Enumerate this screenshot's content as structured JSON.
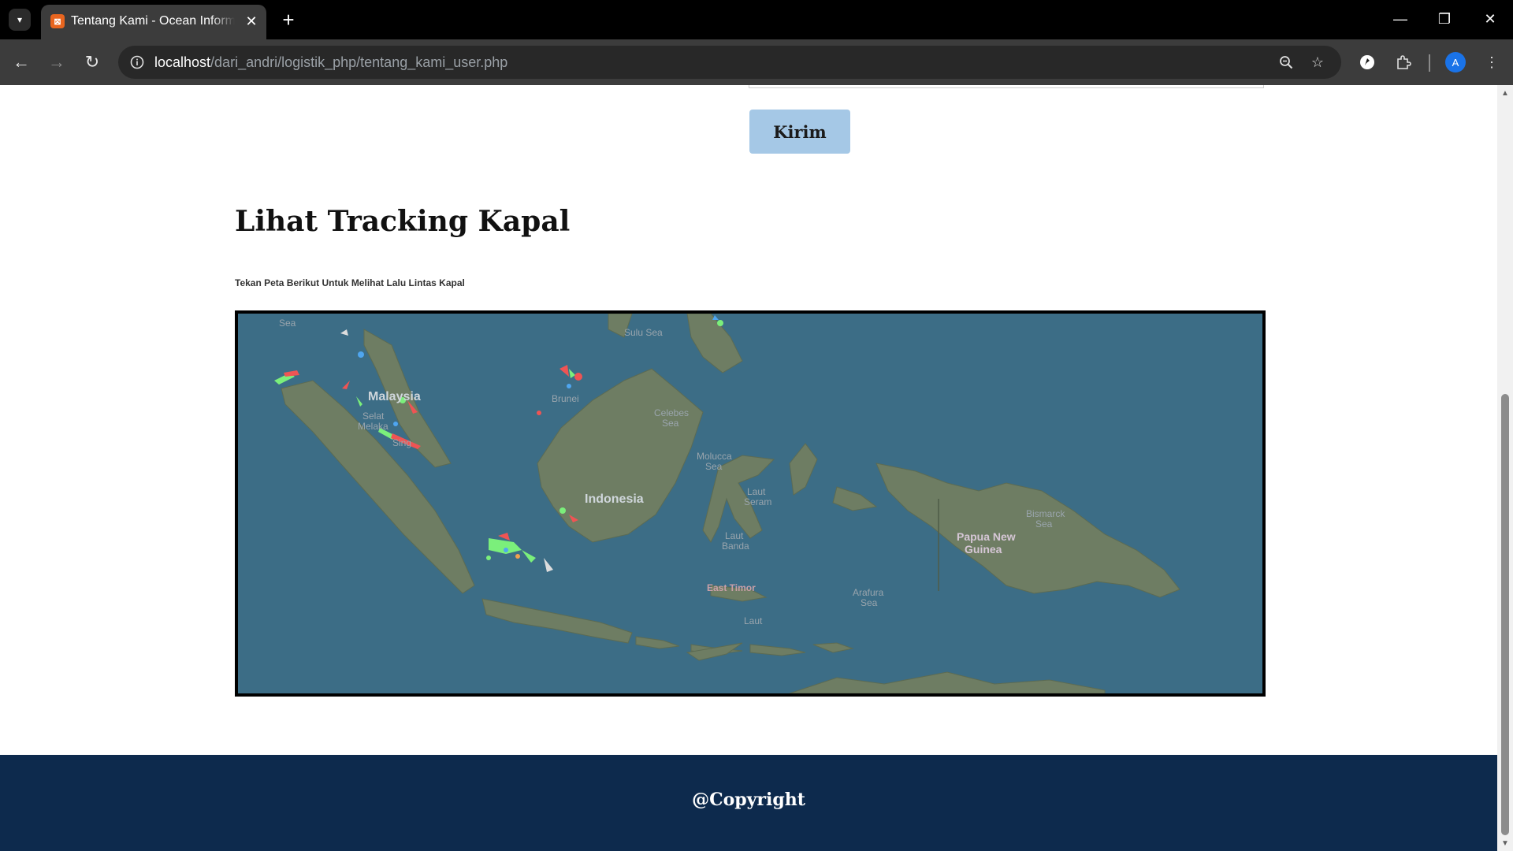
{
  "browser": {
    "tab_title": "Tentang Kami - Ocean Informat",
    "url_host": "localhost",
    "url_path": "/dari_andri/logistik_php/tentang_kami_user.php",
    "profile_initial": "A",
    "accent_color": "#1a73e8"
  },
  "page": {
    "submit_label": "Kirim",
    "section_title": "Lihat Tracking Kapal",
    "section_subtitle": "Tekan Peta Berikut Untuk Melihat Lalu Lintas Kapal",
    "footer_text": "@Copyright",
    "submit_color": "#a5c8e6",
    "footer_color": "#0d2a4d"
  },
  "map": {
    "labels": {
      "andaman": "Sea",
      "sulu": "Sulu Sea",
      "malaysia": "Malaysia",
      "selat": "Selat",
      "melaka": "Melaka",
      "singapore": "Sing",
      "brunei": "Brunei",
      "celebes1": "Celebes",
      "celebes2": "Sea",
      "molucca1": "Molucca",
      "molucca2": "Sea",
      "indonesia": "Indonesia",
      "seram1": "Laut",
      "seram2": "Seram",
      "banda1": "Laut",
      "banda2": "Banda",
      "png1": "Papua New",
      "png2": "Guinea",
      "bismarck1": "Bismarck",
      "bismarck2": "Sea",
      "east_timor": "East Timor",
      "arafura1": "Arafura",
      "arafura2": "Sea",
      "laut_bottom": "Laut"
    },
    "water_color": "#3c6d86",
    "land_color": "#6e7d63"
  }
}
